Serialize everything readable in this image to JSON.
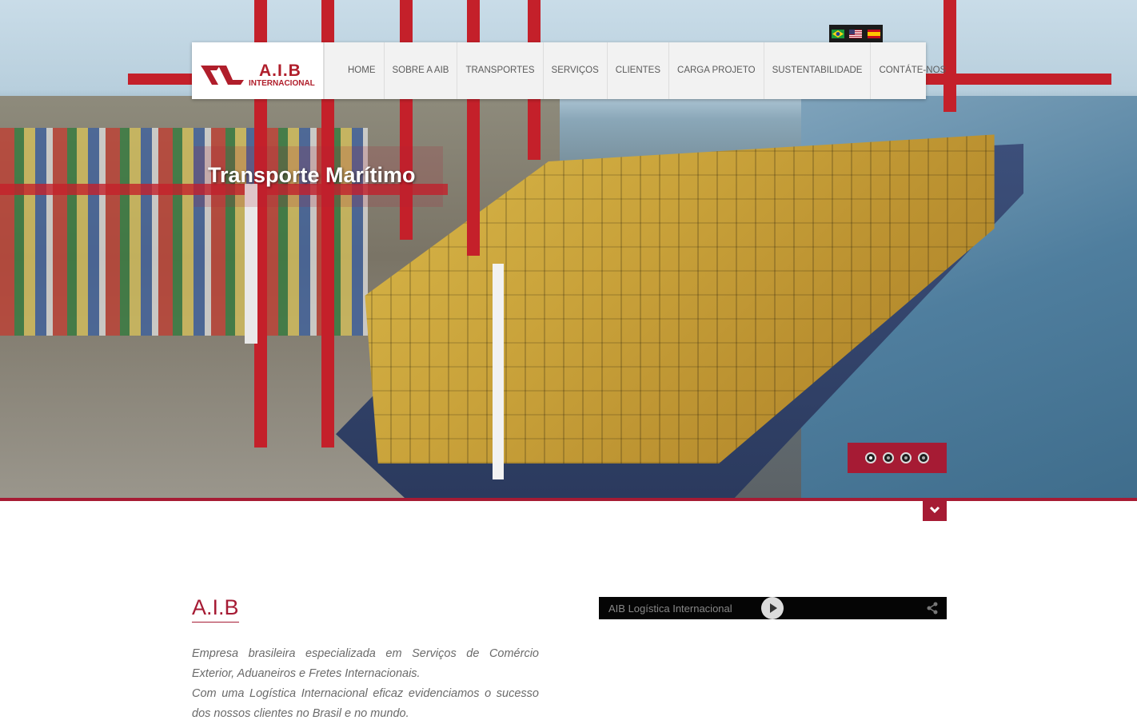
{
  "brand": {
    "title": "A.I.B",
    "subtitle": "INTERNACIONAL",
    "color": "#b01e2b"
  },
  "nav": {
    "items": [
      "HOME",
      "SOBRE A AIB",
      "TRANSPORTES",
      "SERVIÇOS",
      "CLIENTES",
      "CARGA PROJETO",
      "SUSTENTABILIDADE",
      "CONTÁTE-NOS"
    ]
  },
  "languages": [
    "brazil-flag-icon",
    "usa-flag-icon",
    "spain-flag-icon"
  ],
  "hero": {
    "caption": "Transporte Marítimo",
    "slides": 4,
    "active_slide": 1
  },
  "about": {
    "title": "A.I.B",
    "paragraph1": "Empresa brasileira especializada em Serviços de Comércio Exterior, Aduaneiros e Fretes Internacionais.",
    "paragraph2": "Com uma Logística Internacional eficaz evidenciamos o sucesso dos nossos clientes no Brasil e no mundo."
  },
  "video": {
    "title": "AIB Logística Internacional"
  },
  "colors": {
    "accent": "#a61b34",
    "nav_bg": "#f2f2f2",
    "text": "#6a6a6a"
  }
}
